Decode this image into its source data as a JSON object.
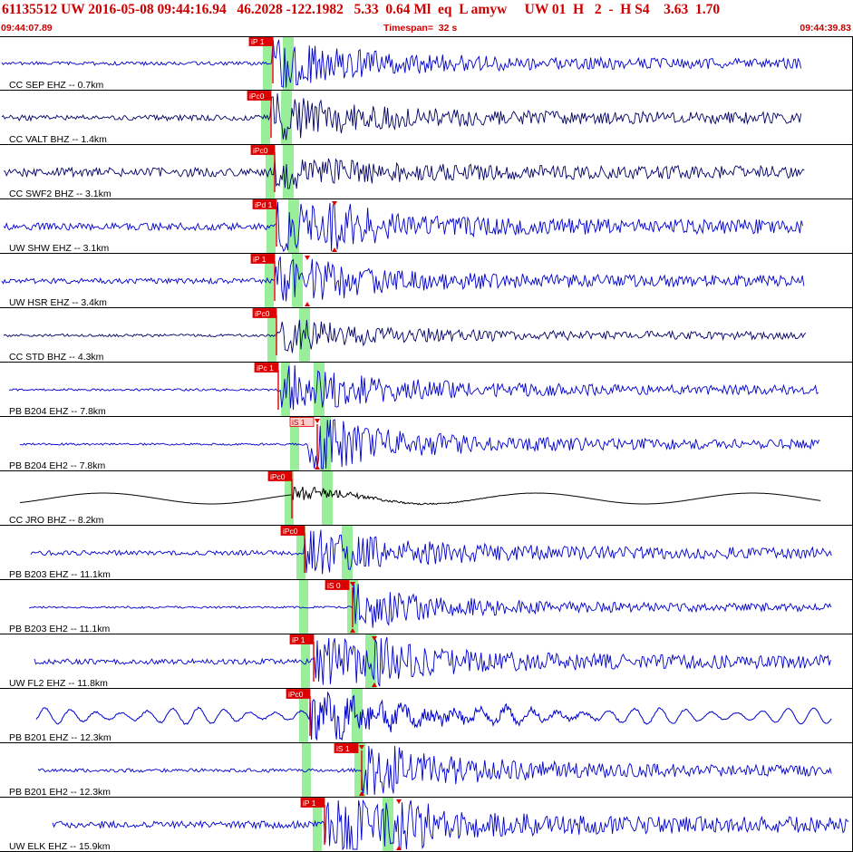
{
  "header": {
    "event_line": "61135512 UW 2016-05-08 09:44:16.94   46.2028 -122.1982   5.33  0.64 Ml  eq  L amyw     UW 01  H   2  -  H S4    3.63  1.70",
    "start_time": "09:44:07.89",
    "timespan": "Timespan=  32 s",
    "end_time": "09:44:39.83"
  },
  "colors": {
    "header_text": "#cc0000",
    "trace_blue": "#0000cc",
    "trace_dark": "#000066",
    "trace_black": "#000000",
    "pick_red": "#dd0000",
    "pick_pink": "#ffcccc",
    "window_green": "#99ee99",
    "divider": "#000000"
  },
  "channels": [
    {
      "label": "CC SEP EHZ -- 0.7km",
      "color": "trace_blue",
      "picks": [
        {
          "label": "iP 1"
        }
      ]
    },
    {
      "label": "CC VALT BHZ -- 1.4km",
      "color": "trace_dark",
      "picks": [
        {
          "label": "iPc0"
        }
      ]
    },
    {
      "label": "CC SWF2 BHZ -- 3.1km",
      "color": "trace_dark",
      "picks": [
        {
          "label": "iPc0"
        }
      ]
    },
    {
      "label": "UW SHW EHZ -- 3.1km",
      "color": "trace_blue",
      "picks": [
        {
          "label": "iPd 1"
        }
      ]
    },
    {
      "label": "UW HSR EHZ -- 3.4km",
      "color": "trace_blue",
      "picks": [
        {
          "label": "iP 1"
        }
      ]
    },
    {
      "label": "CC STD BHZ -- 4.3km",
      "color": "trace_dark",
      "picks": [
        {
          "label": "iPc0"
        }
      ]
    },
    {
      "label": "PB B204 EHZ -- 7.8km",
      "color": "trace_blue",
      "picks": [
        {
          "label": "iPc 1"
        }
      ]
    },
    {
      "label": "PB B204 EH2 -- 7.8km",
      "color": "trace_blue",
      "picks": [
        {
          "label": "iS 1"
        }
      ]
    },
    {
      "label": "CC JRO BHZ -- 8.2km",
      "color": "trace_black",
      "picks": [
        {
          "label": "iPc0"
        }
      ]
    },
    {
      "label": "PB B203 EHZ -- 11.1km",
      "color": "trace_blue",
      "picks": [
        {
          "label": "iPc0"
        }
      ]
    },
    {
      "label": "PB B203 EH2 -- 11.1km",
      "color": "trace_blue",
      "picks": [
        {
          "label": "iS 0"
        }
      ]
    },
    {
      "label": "UW FL2 EHZ -- 11.8km",
      "color": "trace_blue",
      "picks": [
        {
          "label": "iP 1"
        }
      ]
    },
    {
      "label": "PB B201 EHZ -- 12.3km",
      "color": "trace_blue",
      "picks": [
        {
          "label": "iPc0"
        }
      ]
    },
    {
      "label": "PB B201 EH2 -- 12.3km",
      "color": "trace_blue",
      "picks": [
        {
          "label": "iS 1"
        }
      ]
    },
    {
      "label": "UW ELK EHZ -- 15.9km",
      "color": "trace_blue",
      "picks": [
        {
          "label": "iP 1"
        }
      ]
    }
  ]
}
